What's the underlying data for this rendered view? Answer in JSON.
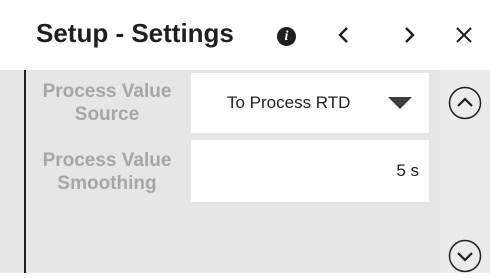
{
  "header": {
    "title": "Setup - Settings",
    "info_icon": "info-icon",
    "prev_icon": "chevron-left-icon",
    "next_icon": "chevron-right-icon",
    "close_icon": "close-icon"
  },
  "settings": [
    {
      "label": "Process Value Source",
      "type": "select",
      "value": "To Process RTD",
      "icon": "caret-down-icon"
    },
    {
      "label": "Process Value Smoothing",
      "type": "input",
      "value": "5 s"
    }
  ],
  "scroll": {
    "up_icon": "chevron-up-circle-icon",
    "down_icon": "chevron-down-circle-icon"
  },
  "colors": {
    "panel": "#e6e6e6",
    "label": "#a6a6a6",
    "text": "#1f1f1f",
    "field": "#ffffff"
  }
}
